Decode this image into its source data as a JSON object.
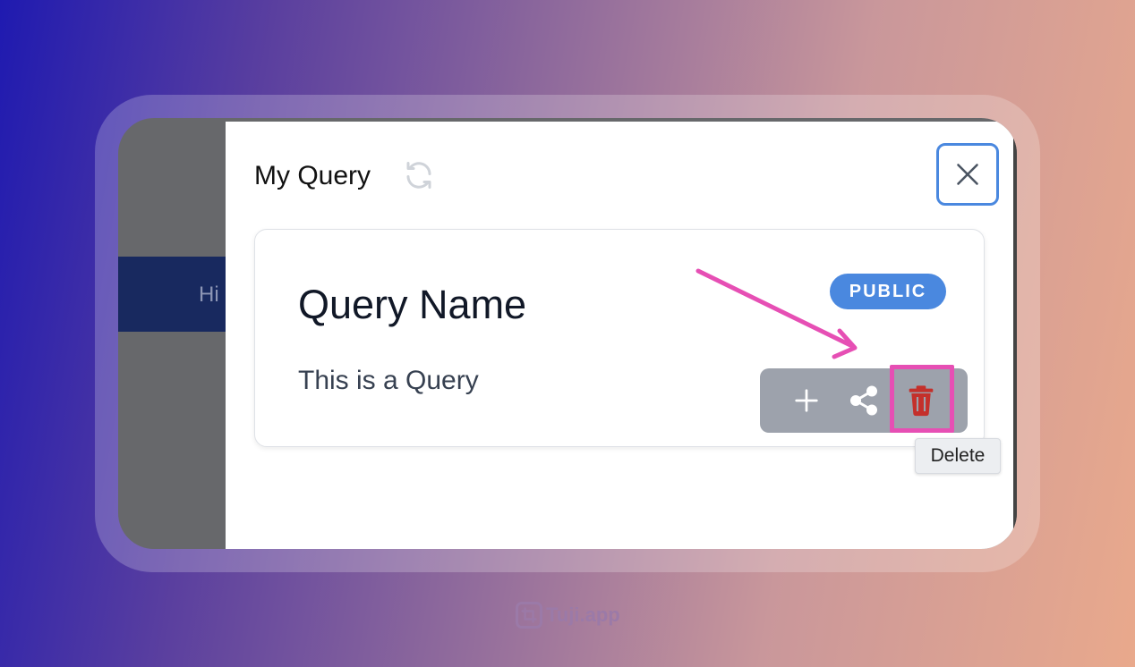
{
  "background": {
    "band_text": "Hi"
  },
  "modal": {
    "title": "My Query",
    "refresh_icon": "refresh-icon",
    "close_icon": "close-icon"
  },
  "card": {
    "name": "Query Name",
    "badge": "PUBLIC",
    "description": "This is a Query",
    "actions": [
      {
        "icon": "plus-icon",
        "label": "Add"
      },
      {
        "icon": "share-icon",
        "label": "Share"
      },
      {
        "icon": "trash-icon",
        "label": "Delete"
      }
    ]
  },
  "tooltip": {
    "text": "Delete"
  },
  "watermark": {
    "text": "Tuji.app"
  },
  "colors": {
    "accent": "#4a88df",
    "delete": "#c4302b",
    "annotation": "#e64fb4"
  }
}
